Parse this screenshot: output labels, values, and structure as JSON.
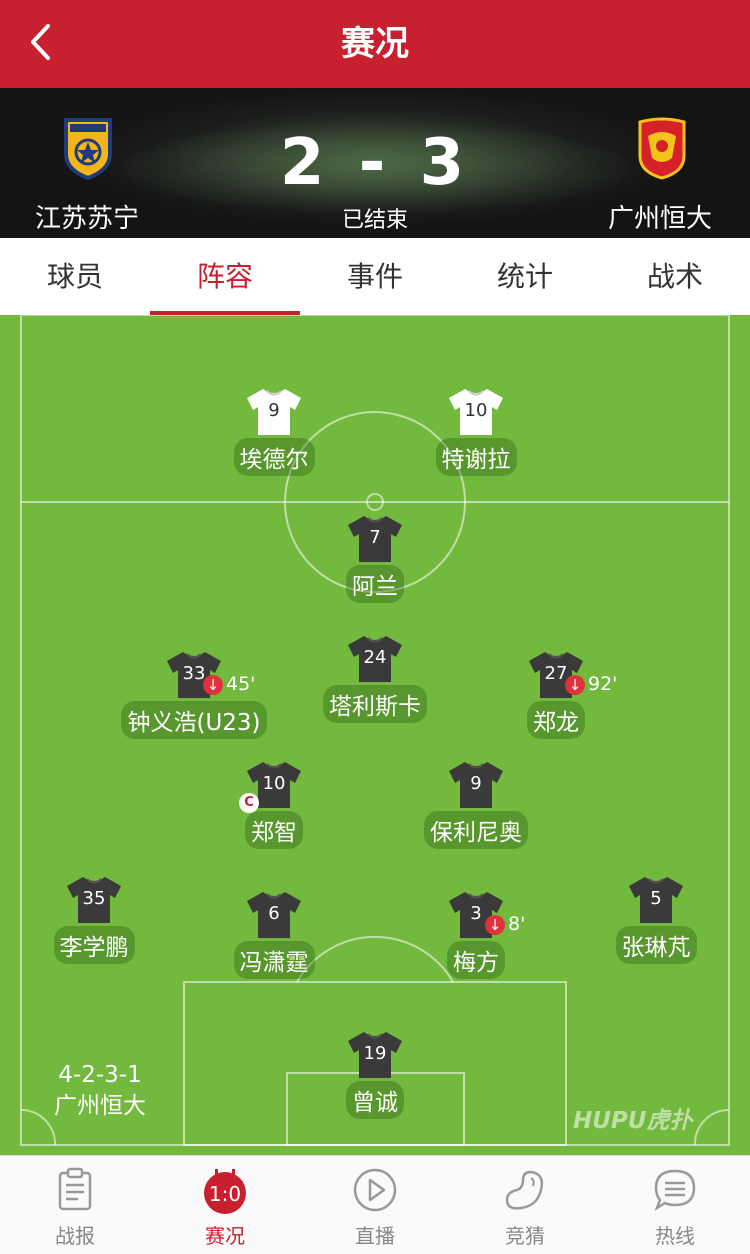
{
  "nav": {
    "title": "赛况"
  },
  "match": {
    "home_team": "江苏苏宁",
    "away_team": "广州恒大",
    "score_text": "2 - 3",
    "status": "已结束"
  },
  "tabs": [
    {
      "label": "球员",
      "active": false
    },
    {
      "label": "阵容",
      "active": true
    },
    {
      "label": "事件",
      "active": false
    },
    {
      "label": "统计",
      "active": false
    },
    {
      "label": "战术",
      "active": false
    }
  ],
  "lineup": {
    "formation": "4-2-3-1",
    "team": "广州恒大",
    "watermark": "HUPU虎扑",
    "players": [
      {
        "number": "9",
        "name": "埃德尔",
        "kit": "white"
      },
      {
        "number": "10",
        "name": "特谢拉",
        "kit": "white"
      },
      {
        "number": "7",
        "name": "阿兰",
        "kit": "dark"
      },
      {
        "number": "33",
        "name": "钟义浩(U23)",
        "kit": "dark",
        "sub": "45'"
      },
      {
        "number": "24",
        "name": "塔利斯卡",
        "kit": "dark"
      },
      {
        "number": "27",
        "name": "郑龙",
        "kit": "dark",
        "sub": "92'"
      },
      {
        "number": "10",
        "name": "郑智",
        "kit": "dark",
        "captain": "C"
      },
      {
        "number": "9",
        "name": "保利尼奥",
        "kit": "dark"
      },
      {
        "number": "35",
        "name": "李学鹏",
        "kit": "dark"
      },
      {
        "number": "6",
        "name": "冯潇霆",
        "kit": "dark"
      },
      {
        "number": "3",
        "name": "梅方",
        "kit": "dark",
        "sub": "8'"
      },
      {
        "number": "5",
        "name": "张琳芃",
        "kit": "dark"
      },
      {
        "number": "19",
        "name": "曾诚",
        "kit": "dark"
      }
    ]
  },
  "bottom_nav": [
    {
      "label": "战报",
      "icon": "clipboard-icon",
      "active": false
    },
    {
      "label": "赛况",
      "icon": "scoreboard-icon",
      "icon_text": "1:0",
      "active": true
    },
    {
      "label": "直播",
      "icon": "play-icon",
      "active": false
    },
    {
      "label": "竞猜",
      "icon": "bean-icon",
      "active": false
    },
    {
      "label": "热线",
      "icon": "chat-icon",
      "active": false
    }
  ],
  "colors": {
    "brand": "#c8202f",
    "pitch": "#72b93d",
    "kit_dark": "#3a3a3a",
    "kit_white": "#ffffff",
    "sub_badge": "#e0323c"
  }
}
